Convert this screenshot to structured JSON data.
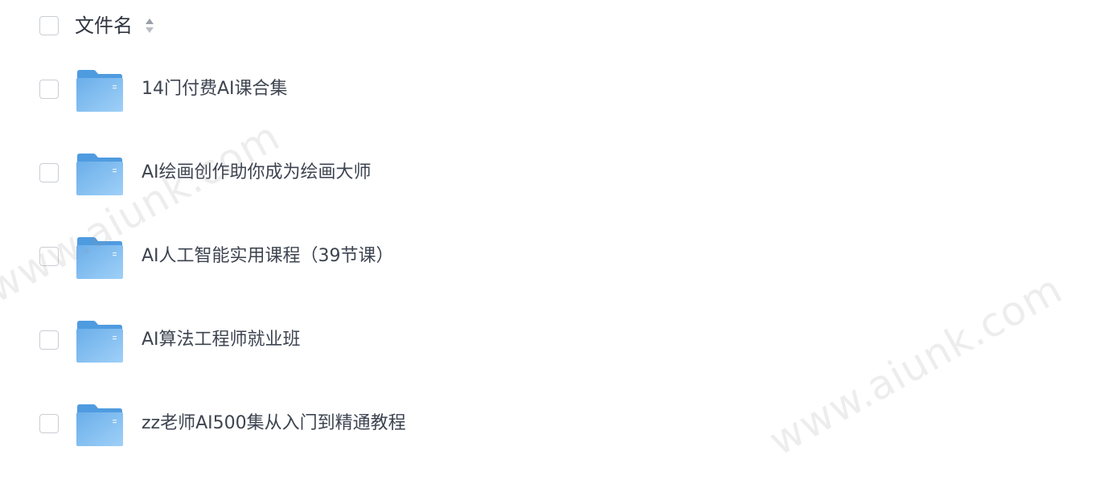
{
  "header": {
    "column_label": "文件名",
    "sort_icon": "sort-icon"
  },
  "files": [
    {
      "name": "14门付费AI课合集",
      "icon": "folder-icon"
    },
    {
      "name": "AI绘画创作助你成为绘画大师",
      "icon": "folder-icon"
    },
    {
      "name": "AI人工智能实用课程（39节课）",
      "icon": "folder-icon"
    },
    {
      "name": "AI算法工程师就业班",
      "icon": "folder-icon"
    },
    {
      "name": "zz老师AI500集从入门到精通教程",
      "icon": "folder-icon"
    }
  ],
  "watermark": {
    "text": "www.aiunk.com"
  },
  "colors": {
    "folder": "#6fb3ec",
    "checkbox_border": "#c9cdd4",
    "text": "#3d4450"
  }
}
